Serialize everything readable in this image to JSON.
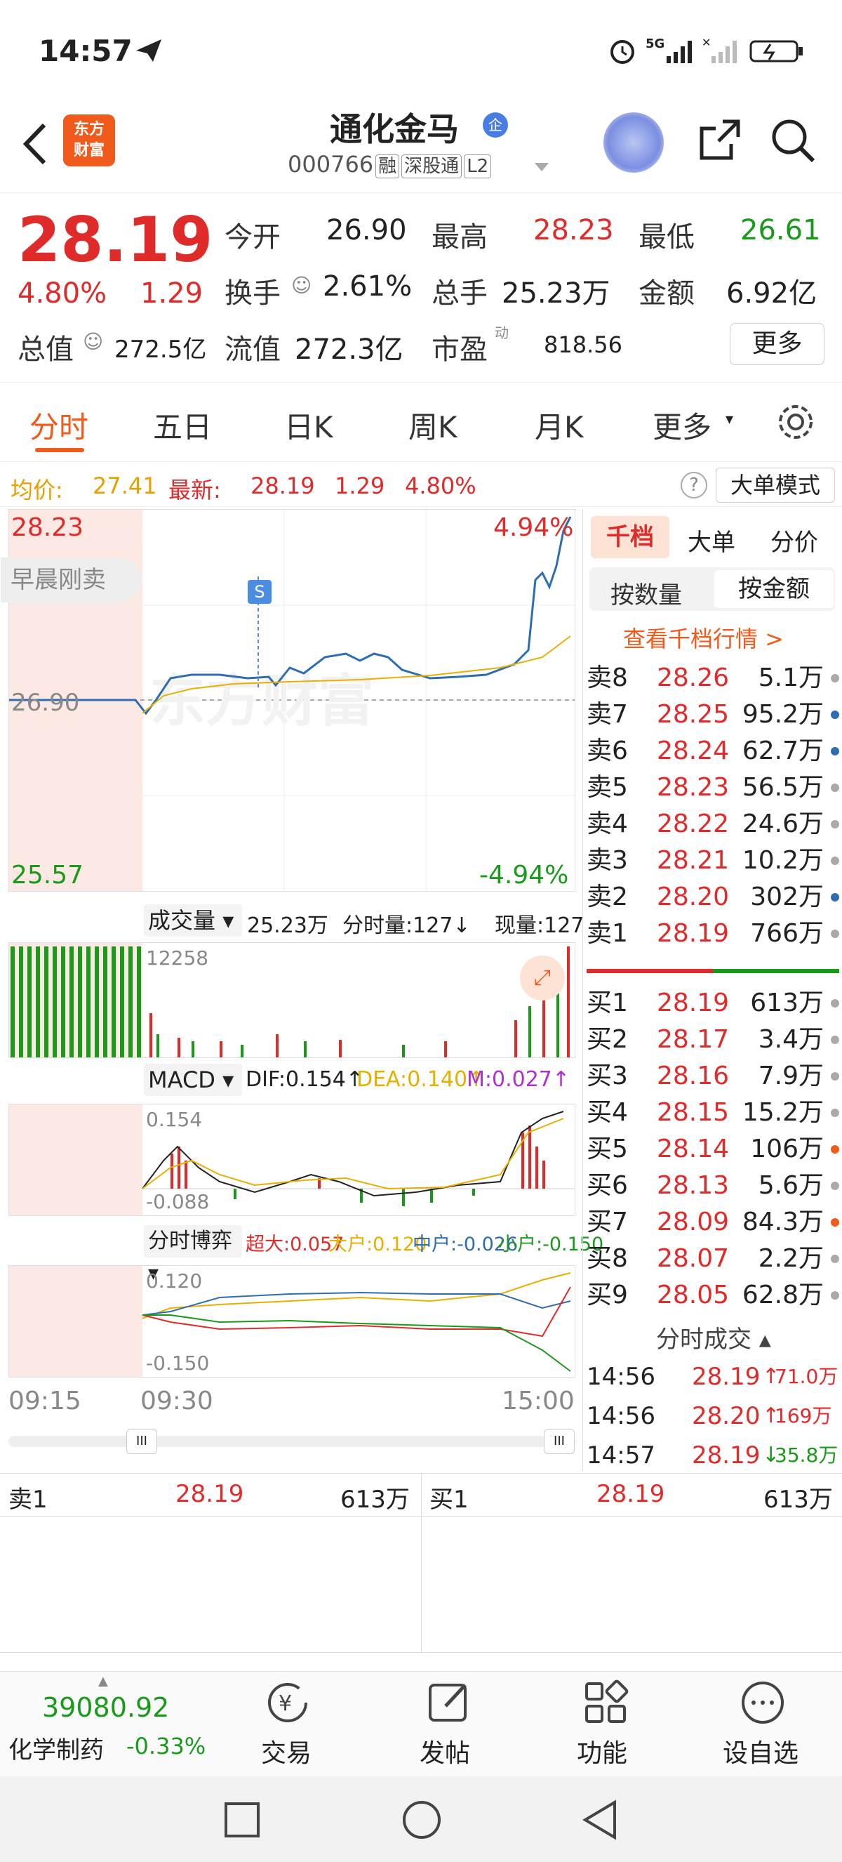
{
  "status": {
    "time": "14:57"
  },
  "header": {
    "logo_text_1": "东方",
    "logo_text_2": "财富",
    "title": "通化金马",
    "title_badge": "企",
    "code": "000766",
    "tags": [
      "融",
      "深股通",
      "L2"
    ]
  },
  "quote": {
    "price": "28.19",
    "pct": "4.80%",
    "change": "1.29",
    "open_label": "今开",
    "open": "26.90",
    "high_label": "最高",
    "high": "28.23",
    "low_label": "最低",
    "low": "26.61",
    "turnover_label": "换手",
    "turnover": "2.61%",
    "volume_label": "总手",
    "volume": "25.23万",
    "amount_label": "金额",
    "amount": "6.92亿",
    "mktcap_label": "总值",
    "mktcap": "272.5亿",
    "float_label": "流值",
    "float": "272.3亿",
    "pe_label": "市盈",
    "pe_sup": "动",
    "pe": "818.56",
    "more": "更多"
  },
  "tabs": [
    "分时",
    "五日",
    "日K",
    "周K",
    "月K",
    "更多"
  ],
  "avgbar": {
    "avg_label": "均价:",
    "avg": "27.41",
    "last_label": "最新:",
    "last": "28.19",
    "chg": "1.29",
    "pct": "4.80%",
    "mode_btn": "大单模式"
  },
  "chart": {
    "ymax": "28.23",
    "ymin": "25.57",
    "pct_max": "4.94%",
    "pct_min": "-4.94%",
    "mid": "26.90",
    "early": "早晨刚卖",
    "marker": "S",
    "watermark": "东方财富",
    "vol_label": "成交量",
    "vol_total": "25.23万",
    "vol_fen": "分时量:127↓",
    "vol_now": "现量:127",
    "vol_max": "12258",
    "macd_label": "MACD",
    "dif": "DIF:0.154↑",
    "dea": "DEA:0.140↑",
    "m": "M:0.027↑",
    "macd_top": "0.154",
    "macd_bot": "-0.088",
    "game_label": "分时博弈",
    "cd": "超大:0.057",
    "dh": "大户:0.120",
    "zh": "中户:-0.026",
    "xh": "小户:-0.150",
    "game_top": "0.120",
    "game_bot": "-0.150",
    "t1": "09:15",
    "t2": "09:30",
    "t3": "15:00"
  },
  "colors": {
    "red": "#e02b2b",
    "green": "#1a9a1a",
    "orange": "#f05a1b",
    "blue": "#2f6db3"
  },
  "orderbook": {
    "tabs": [
      "千档",
      "大单",
      "分价"
    ],
    "sub_tabs": [
      "按数量",
      "按金额"
    ],
    "link": "查看千档行情 >",
    "sells": [
      {
        "label": "卖8",
        "price": "28.26",
        "vol": "5.1万",
        "dot": "gray"
      },
      {
        "label": "卖7",
        "price": "28.25",
        "vol": "95.2万",
        "dot": "blue"
      },
      {
        "label": "卖6",
        "price": "28.24",
        "vol": "62.7万",
        "dot": "blue"
      },
      {
        "label": "卖5",
        "price": "28.23",
        "vol": "56.5万",
        "dot": "gray"
      },
      {
        "label": "卖4",
        "price": "28.22",
        "vol": "24.6万",
        "dot": "gray"
      },
      {
        "label": "卖3",
        "price": "28.21",
        "vol": "10.2万",
        "dot": "gray"
      },
      {
        "label": "卖2",
        "price": "28.20",
        "vol": "302万",
        "dot": "blue"
      },
      {
        "label": "卖1",
        "price": "28.19",
        "vol": "766万",
        "dot": "gray"
      }
    ],
    "buys": [
      {
        "label": "买1",
        "price": "28.19",
        "vol": "613万",
        "dot": "gray"
      },
      {
        "label": "买2",
        "price": "28.17",
        "vol": "3.4万",
        "dot": "gray"
      },
      {
        "label": "买3",
        "price": "28.16",
        "vol": "7.9万",
        "dot": "gray"
      },
      {
        "label": "买4",
        "price": "28.15",
        "vol": "15.2万",
        "dot": "gray"
      },
      {
        "label": "买5",
        "price": "28.14",
        "vol": "106万",
        "dot": "orange"
      },
      {
        "label": "买6",
        "price": "28.13",
        "vol": "5.6万",
        "dot": "gray"
      },
      {
        "label": "买7",
        "price": "28.09",
        "vol": "84.3万",
        "dot": "orange"
      },
      {
        "label": "买8",
        "price": "28.07",
        "vol": "2.2万",
        "dot": "gray"
      },
      {
        "label": "买9",
        "price": "28.05",
        "vol": "62.8万",
        "dot": "gray"
      }
    ],
    "ticks_title": "分时成交",
    "ticks": [
      {
        "time": "14:56",
        "price": "28.19",
        "arrow": "↑",
        "vol": "71.0万",
        "dir": "up"
      },
      {
        "time": "14:56",
        "price": "28.20",
        "arrow": "↑",
        "vol": "169万",
        "dir": "up"
      },
      {
        "time": "14:57",
        "price": "28.19",
        "arrow": "↓",
        "vol": "35.8万",
        "dir": "down"
      }
    ]
  },
  "bottom_quote": {
    "sell_label": "卖1",
    "sell_price": "28.19",
    "sell_vol": "613万",
    "buy_label": "买1",
    "buy_price": "28.19",
    "buy_vol": "613万"
  },
  "bottom_bar": {
    "index_value": "39080.92",
    "index_name": "化学制药",
    "index_pct": "-0.33%",
    "items": [
      "交易",
      "发帖",
      "功能",
      "设自选"
    ]
  }
}
